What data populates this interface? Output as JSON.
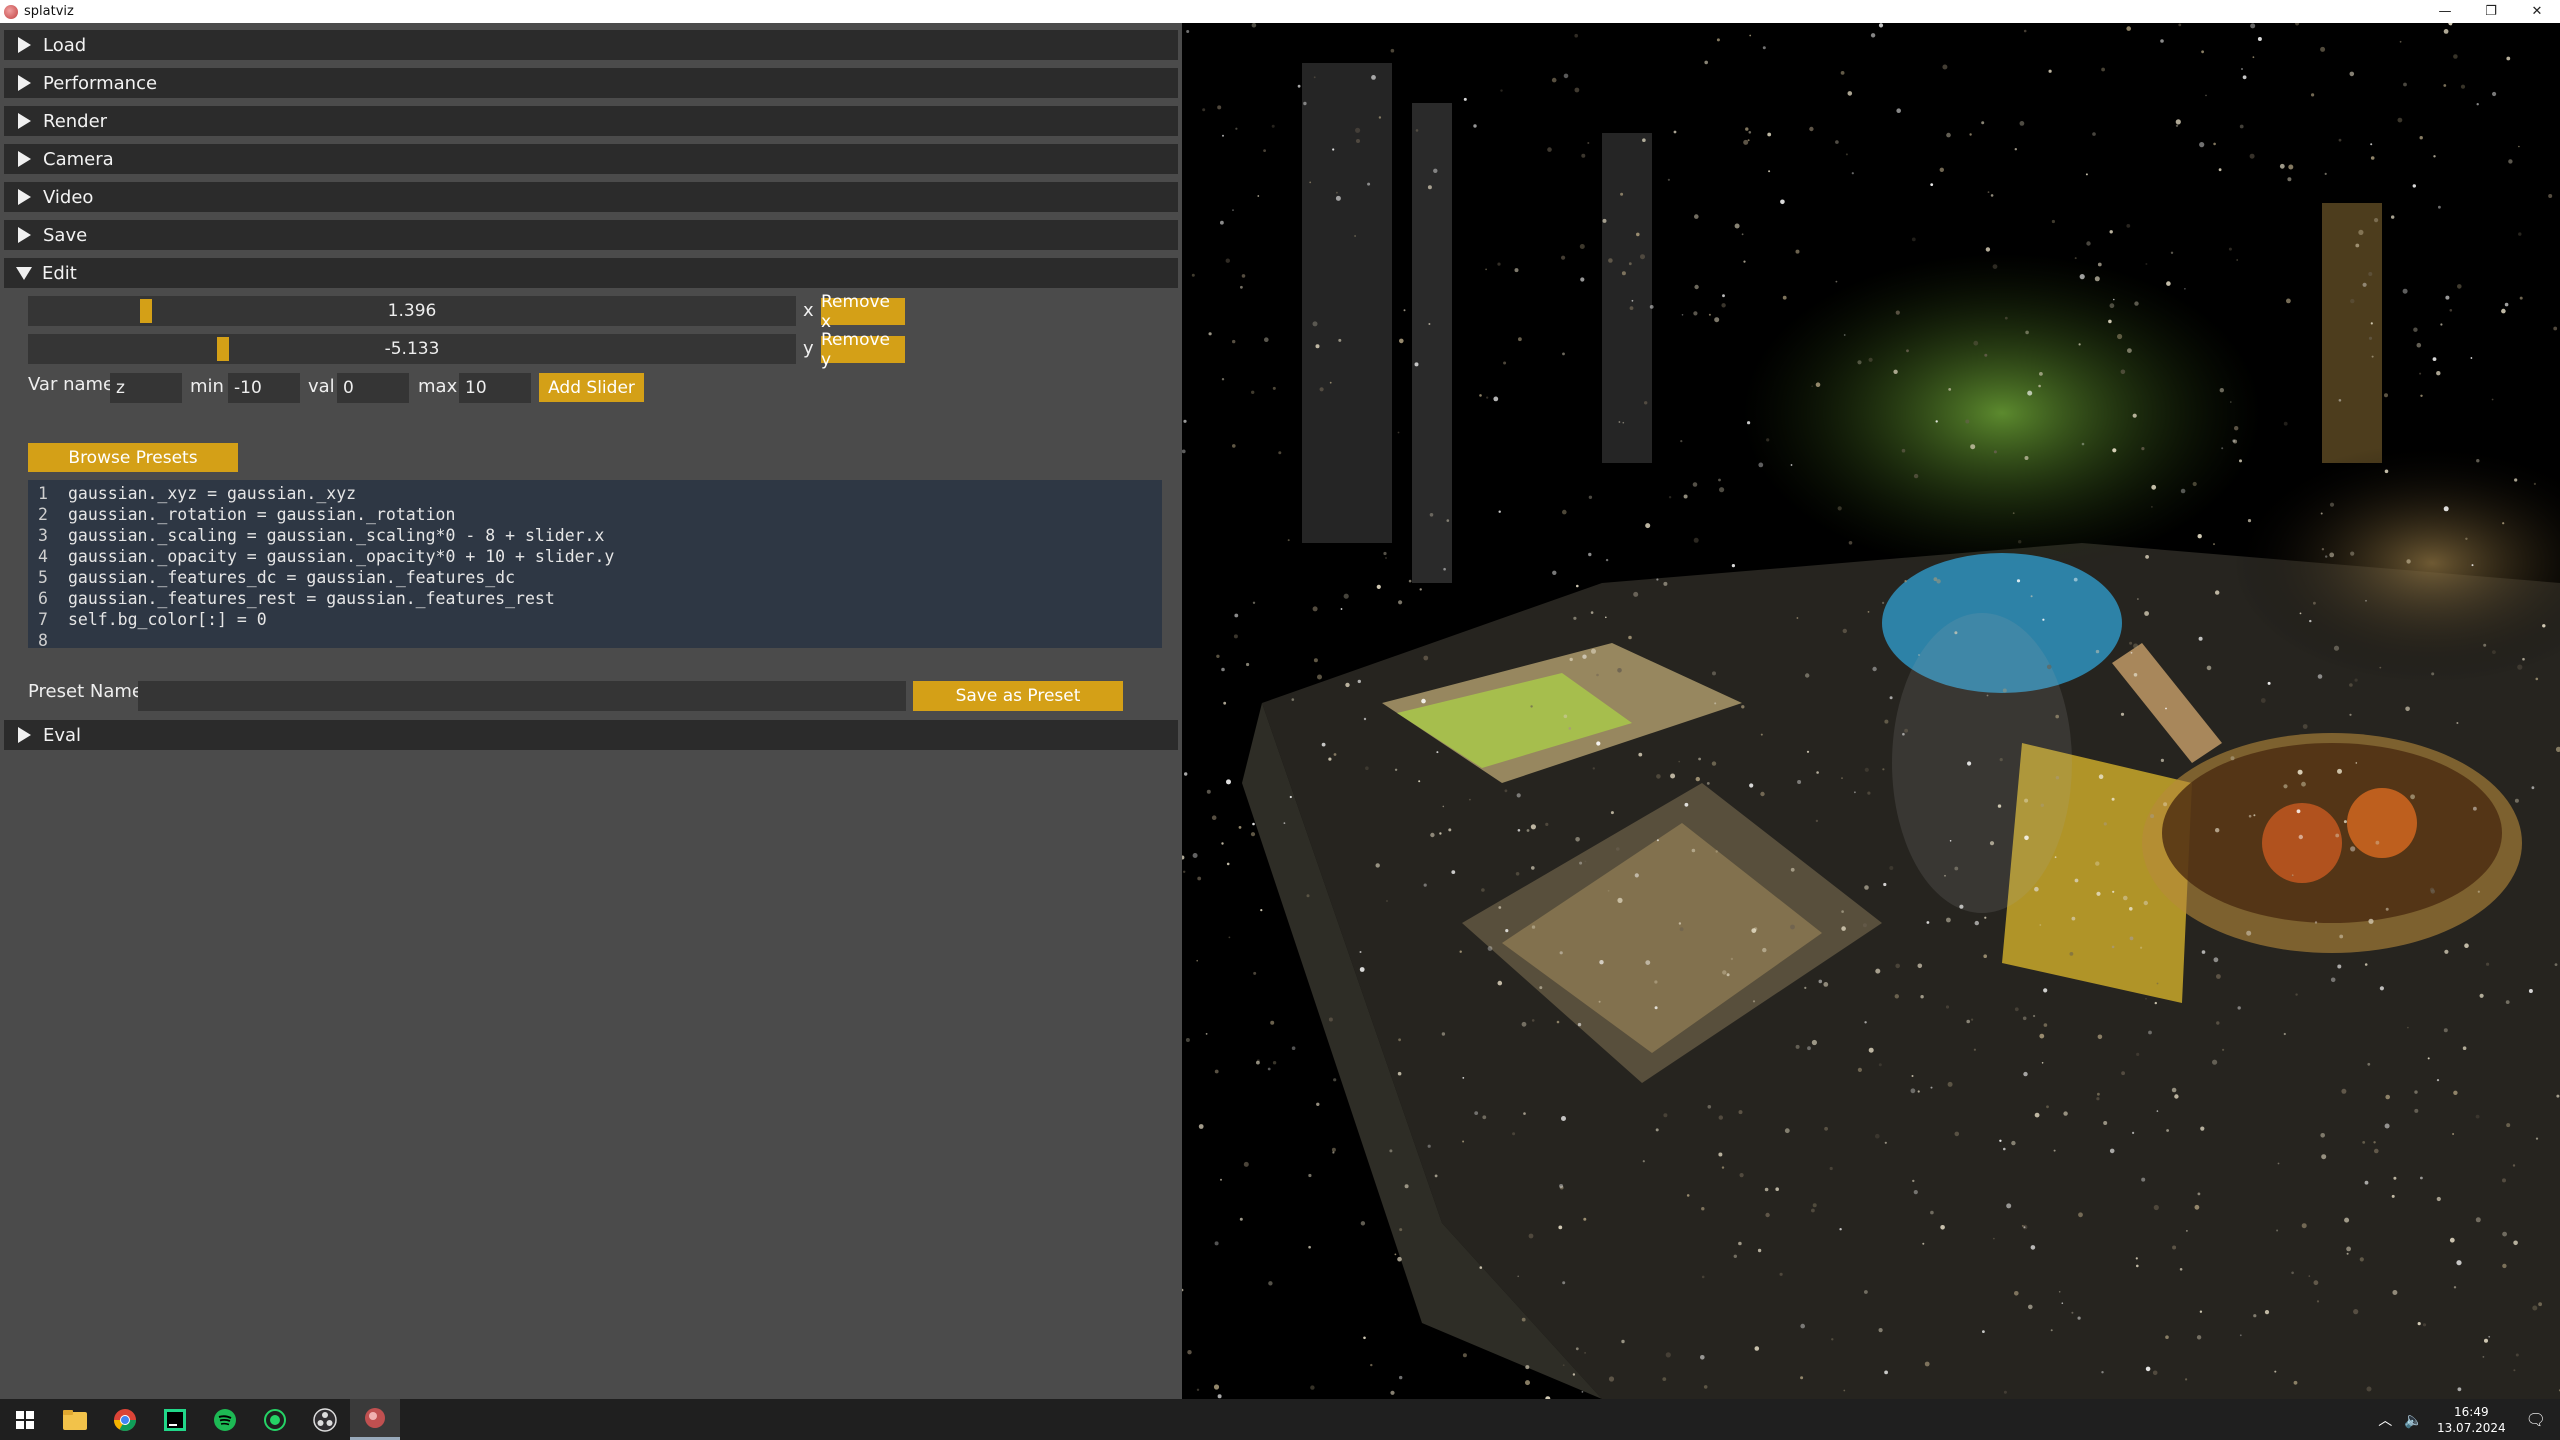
{
  "window": {
    "title": "splatviz",
    "controls": [
      "—",
      "❐",
      "✕"
    ]
  },
  "panel": {
    "sections": {
      "load": "Load",
      "performance": "Performance",
      "render": "Render",
      "camera": "Camera",
      "video": "Video",
      "save": "Save",
      "edit": "Edit",
      "eval": "Eval"
    },
    "sliders": [
      {
        "value": "1.396",
        "var": "x",
        "remove_label": "Remove x",
        "fraction": 0.148
      },
      {
        "value": "-5.133",
        "var": "y",
        "remove_label": "Remove y",
        "fraction": 0.25
      }
    ],
    "new_slider": {
      "var_name_label": "Var name",
      "var_name_value": "z",
      "min_label": "min",
      "min_value": "-10",
      "val_label": "val",
      "val_value": "0",
      "max_label": "max",
      "max_value": "10",
      "add_label": "Add Slider"
    },
    "browse_presets_label": "Browse Presets",
    "code_lines": [
      {
        "n": "1",
        "text": "gaussian._xyz = gaussian._xyz"
      },
      {
        "n": "2",
        "text": "gaussian._rotation = gaussian._rotation"
      },
      {
        "n": "3",
        "text": "gaussian._scaling = gaussian._scaling*0 - 8 + slider.x"
      },
      {
        "n": "4",
        "text": "gaussian._opacity = gaussian._opacity*0 + 10 + slider.y"
      },
      {
        "n": "5",
        "text": "gaussian._features_dc = gaussian._features_dc"
      },
      {
        "n": "6",
        "text": "gaussian._features_rest = gaussian._features_rest"
      },
      {
        "n": "7",
        "text": "self.bg_color[:] = 0"
      },
      {
        "n": "8",
        "text": ""
      }
    ],
    "preset_name_label": "Preset Name",
    "preset_name_value": "",
    "save_preset_label": "Save as Preset"
  },
  "viewport": {
    "content": "gaussian-splat-render"
  },
  "taskbar": {
    "icons": [
      "windows-start-icon",
      "file-explorer-icon",
      "chrome-icon",
      "pycharm-icon",
      "spotify-icon",
      "whatsapp-icon",
      "obs-icon",
      "splatviz-icon"
    ],
    "time": "16:49",
    "date": "13.07.2024"
  },
  "colors": {
    "accent": "#d4a017",
    "panel_bg": "#4b4b4b",
    "header_bg": "#2b2b2b",
    "code_bg": "#2e3744"
  }
}
